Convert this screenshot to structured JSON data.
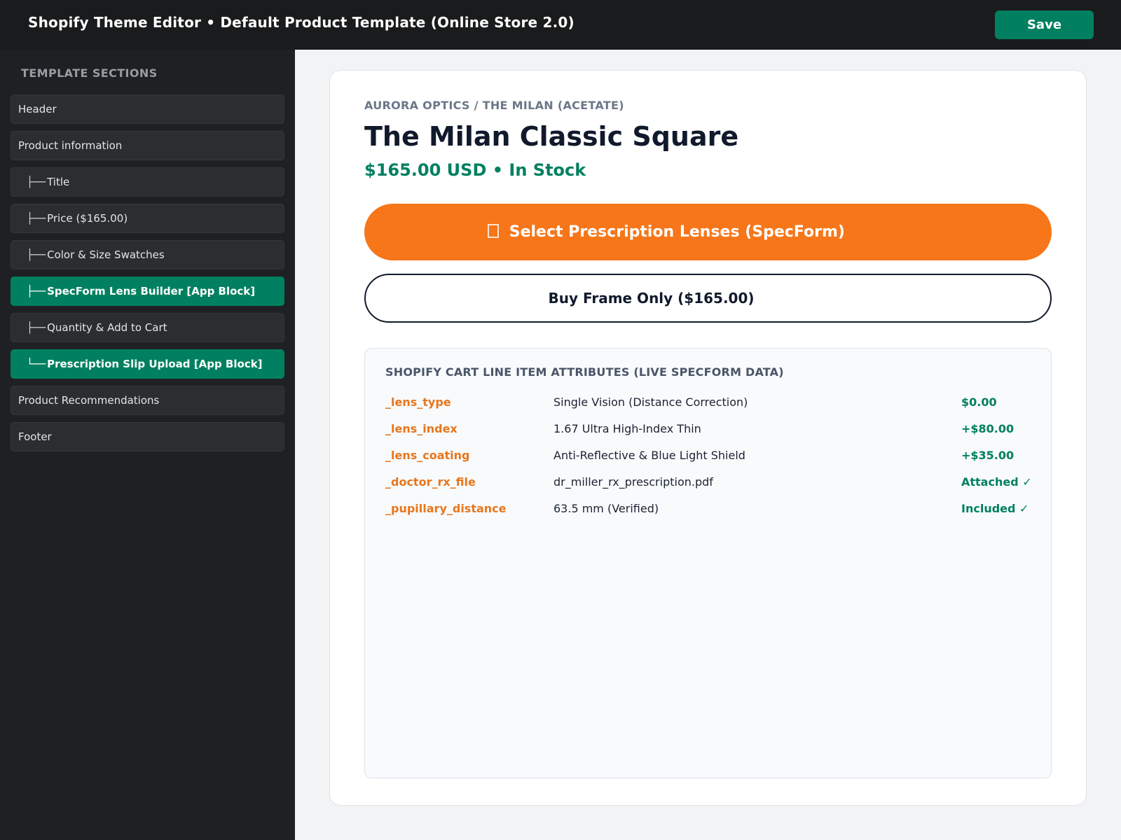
{
  "topbar": {
    "title": "Shopify Theme Editor  •  Default Product Template (Online Store 2.0)",
    "save_label": "Save"
  },
  "sidebar": {
    "heading": "TEMPLATE SECTIONS",
    "items": [
      {
        "label": "Header",
        "tree": "",
        "child": false,
        "active": false
      },
      {
        "label": "Product information",
        "tree": "",
        "child": false,
        "active": false
      },
      {
        "label": "Title",
        "tree": "├──",
        "child": true,
        "active": false
      },
      {
        "label": "Price ($165.00)",
        "tree": "├──",
        "child": true,
        "active": false
      },
      {
        "label": "Color & Size Swatches",
        "tree": "├──",
        "child": true,
        "active": false
      },
      {
        "label": "SpecForm Lens Builder [App Block]",
        "tree": "├──",
        "child": true,
        "active": true
      },
      {
        "label": "Quantity & Add to Cart",
        "tree": "├──",
        "child": true,
        "active": false
      },
      {
        "label": "Prescription Slip Upload [App Block]",
        "tree": "└──",
        "child": true,
        "active": true
      },
      {
        "label": "Product Recommendations",
        "tree": "",
        "child": false,
        "active": false
      },
      {
        "label": "Footer",
        "tree": "",
        "child": false,
        "active": false
      }
    ]
  },
  "product": {
    "breadcrumb": "AURORA OPTICS / THE MILAN (ACETATE)",
    "title": "The Milan Classic Square",
    "price_line": "$165.00 USD  •  In Stock",
    "rx_button_icon": "eyeglasses-icon",
    "rx_button_label": "Select Prescription Lenses (SpecForm)",
    "frame_button_label": "Buy Frame Only ($165.00)"
  },
  "attributes": {
    "heading": "SHOPIFY CART LINE ITEM ATTRIBUTES (LIVE SPECFORM DATA)",
    "rows": [
      {
        "key": "_lens_type",
        "value": "Single Vision (Distance Correction)",
        "price": "$0.00"
      },
      {
        "key": "_lens_index",
        "value": "1.67 Ultra High-Index Thin",
        "price": "+$80.00"
      },
      {
        "key": "_lens_coating",
        "value": "Anti-Reflective & Blue Light Shield",
        "price": "+$35.00"
      },
      {
        "key": "_doctor_rx_file",
        "value": "dr_miller_rx_prescription.pdf",
        "price": "Attached ✓"
      },
      {
        "key": "_pupillary_distance",
        "value": "63.5 mm (Verified)",
        "price": "Included ✓"
      }
    ]
  },
  "colors": {
    "accent_green": "#008060",
    "accent_orange": "#f67619",
    "topbar_bg": "#1a1b1c",
    "sidebar_bg": "#1f2023"
  }
}
